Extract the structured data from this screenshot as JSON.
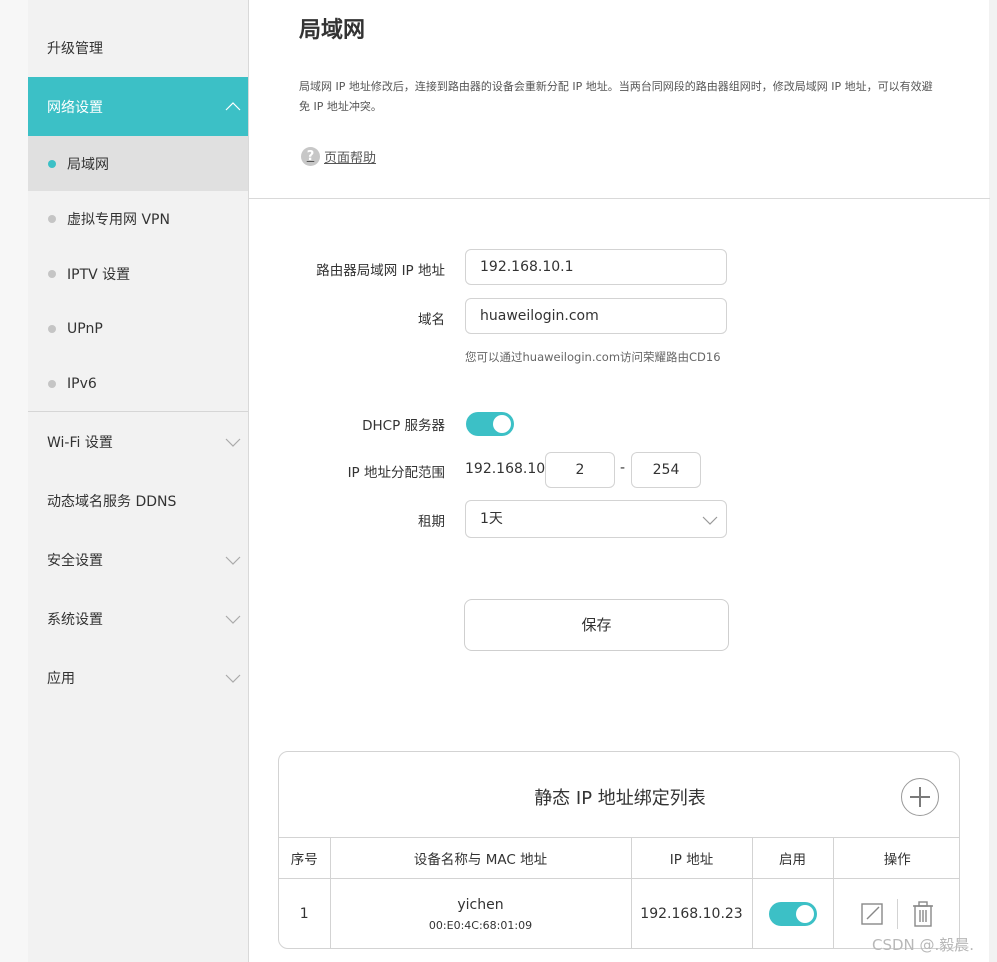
{
  "sidebar": {
    "items": [
      {
        "label": "升级管理"
      },
      {
        "label": "网络设置"
      },
      {
        "label": "Wi-Fi 设置"
      },
      {
        "label": "动态域名服务 DDNS"
      },
      {
        "label": "安全设置"
      },
      {
        "label": "系统设置"
      },
      {
        "label": "应用"
      }
    ],
    "sub_items": [
      {
        "label": "局域网"
      },
      {
        "label": "虚拟专用网 VPN"
      },
      {
        "label": "IPTV 设置"
      },
      {
        "label": "UPnP"
      },
      {
        "label": "IPv6"
      }
    ]
  },
  "main": {
    "title": "局域网",
    "description": "局域网 IP 地址修改后，连接到路由器的设备会重新分配 IP 地址。当两台同网段的路由器组网时，修改局域网 IP 地址，可以有效避免 IP 地址冲突。",
    "help_icon_glyph": "?",
    "help_label": "页面帮助"
  },
  "form": {
    "lan_ip_label": "路由器局域网 IP 地址",
    "lan_ip_value": "192.168.10.1",
    "domain_label": "域名",
    "domain_value": "huaweilogin.com",
    "domain_hint": "您可以通过huaweilogin.com访问荣耀路由CD16",
    "dhcp_label": "DHCP 服务器",
    "dhcp_enabled": true,
    "range_label": "IP 地址分配范围",
    "range_prefix": "192.168.10.",
    "range_start": "2",
    "range_dash": "-",
    "range_end": "254",
    "lease_label": "租期",
    "lease_value": "1天",
    "save_label": "保存"
  },
  "static_table": {
    "title": "静态 IP 地址绑定列表",
    "columns": [
      "序号",
      "设备名称与 MAC 地址",
      "IP 地址",
      "启用",
      "操作"
    ],
    "rows": [
      {
        "index": "1",
        "name": "yichen",
        "mac": "00:E0:4C:68:01:09",
        "ip": "192.168.10.23",
        "enabled": true
      }
    ]
  },
  "watermark": "CSDN @.毅晨.",
  "colors": {
    "accent": "#3cc0c6"
  }
}
